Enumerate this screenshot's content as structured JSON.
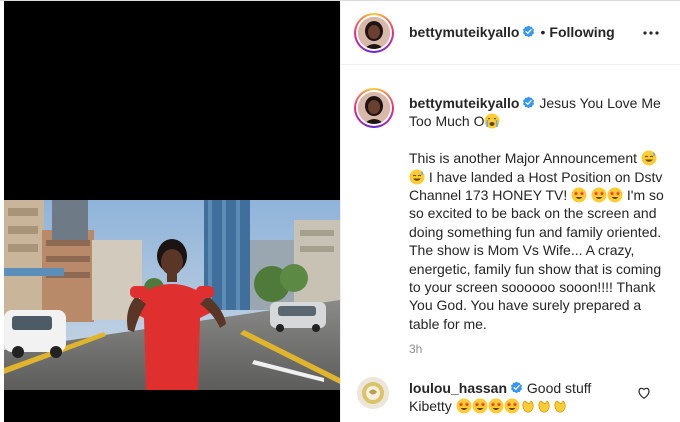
{
  "post": {
    "username": "bettymuteikyallo",
    "follow_status": "Following",
    "separator": "•",
    "caption_title": "Jesus You Love Me Too Much O",
    "caption_body_1": "This is another Major Announcement",
    "caption_body_2": "I have landed a Host Position on Dstv Channel 173 HONEY TV!",
    "caption_body_3": "I'm so so excited to be back on the screen and doing something fun and family oriented. The show is Mom Vs Wife... A crazy, energetic, family fun show that is coming to your screen soooooo sooon!!!! Thank You God. You have surely prepared a table for me.",
    "time_ago": "3h"
  },
  "comment": {
    "username": "loulou_hassan",
    "text_1": "Good stuff",
    "text_2": "Kibetty"
  },
  "icons": {
    "verified": "verified-badge-icon",
    "more": "more-options-icon",
    "like": "heart-icon"
  },
  "colors": {
    "verified_blue": "#3897f0",
    "secondary_text": "#8e8e8e",
    "border": "#efefef"
  }
}
